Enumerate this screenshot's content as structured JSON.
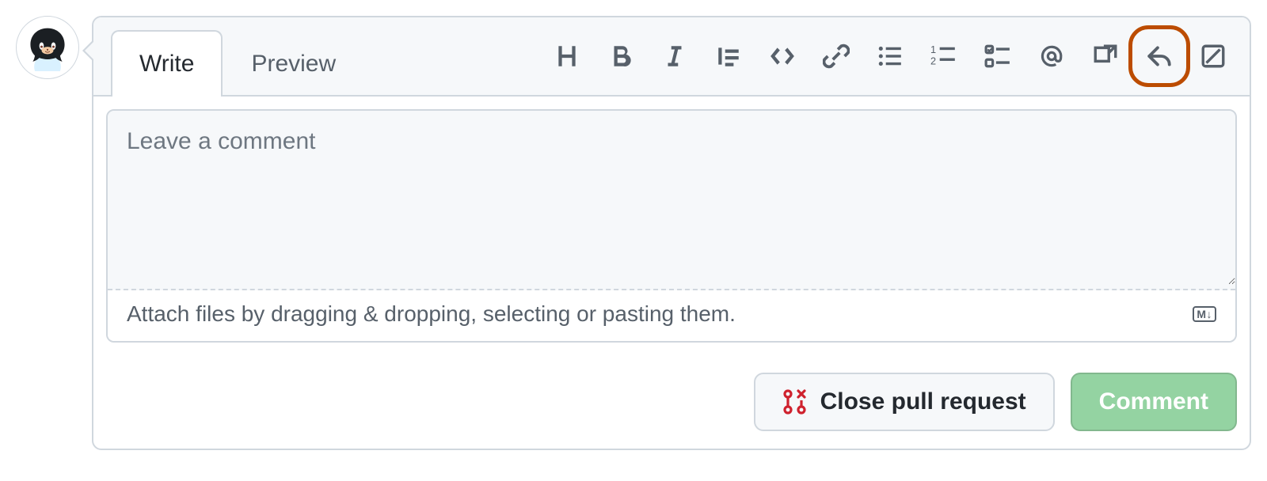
{
  "tabs": {
    "write": "Write",
    "preview": "Preview"
  },
  "toolbar": {
    "heading": "heading-icon",
    "bold": "bold-icon",
    "italic": "italic-icon",
    "quote": "quote-icon",
    "code": "code-icon",
    "link": "link-icon",
    "ul": "unordered-list-icon",
    "ol": "ordered-list-icon",
    "tasklist": "task-list-icon",
    "mention": "mention-icon",
    "reference": "cross-reference-icon",
    "reply": "reply-icon",
    "suggestion": "diff-icon"
  },
  "editor": {
    "placeholder": "Leave a comment",
    "value": "",
    "attach_hint": "Attach files by dragging & dropping, selecting or pasting them.",
    "markdown_badge": "M↓"
  },
  "actions": {
    "close_label": "Close pull request",
    "comment_label": "Comment"
  }
}
